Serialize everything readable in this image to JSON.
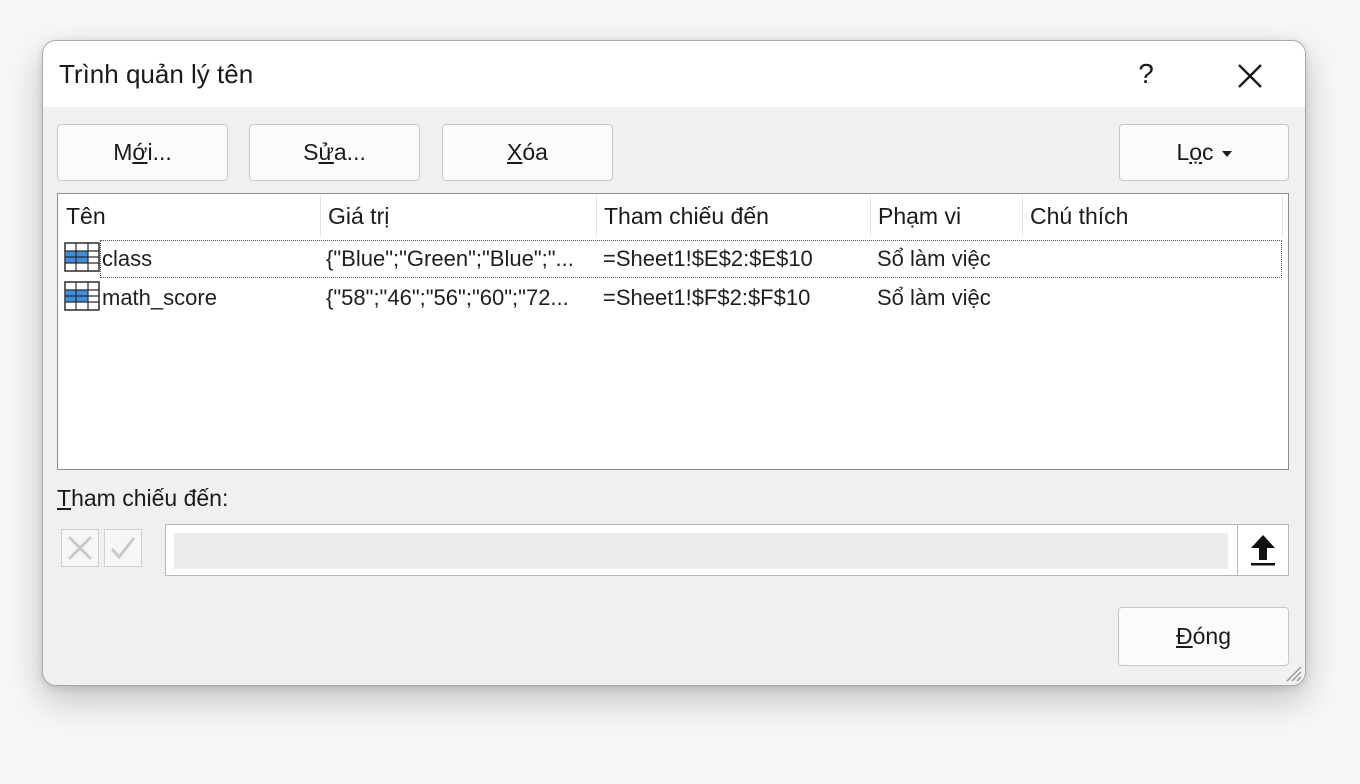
{
  "dialog": {
    "title": "Trình quản lý tên",
    "help_label": "?",
    "close_icon": "close-icon"
  },
  "toolbar": {
    "new_pre": "M",
    "new_acc": "ớ",
    "new_post": "i...",
    "edit_pre": "S",
    "edit_acc": "ử",
    "edit_post": "a...",
    "delete_pre": "",
    "delete_acc": "X",
    "delete_post": "óa",
    "filter_pre": "L",
    "filter_acc": "ọ",
    "filter_post": "c"
  },
  "list": {
    "columns": [
      "Tên",
      "Giá trị",
      "Tham chiếu đến",
      "Phạm vi",
      "Chú thích"
    ],
    "rows": [
      {
        "name": "class",
        "value": "{\"Blue\";\"Green\";\"Blue\";\"...",
        "refers_to": "=Sheet1!$E$2:$E$10",
        "scope": "Sổ làm việc",
        "comment": ""
      },
      {
        "name": "math_score",
        "value": "{\"58\";\"46\";\"56\";\"60\";\"72...",
        "refers_to": "=Sheet1!$F$2:$F$10",
        "scope": "Sổ làm việc",
        "comment": ""
      }
    ]
  },
  "refers": {
    "label_acc": "T",
    "label_rest": "ham chiếu đến:",
    "value": ""
  },
  "footer": {
    "close_acc": "Đ",
    "close_rest": "óng"
  },
  "colors": {
    "icon_blue": "#3b8ee0",
    "icon_border": "#2b2b2b"
  }
}
